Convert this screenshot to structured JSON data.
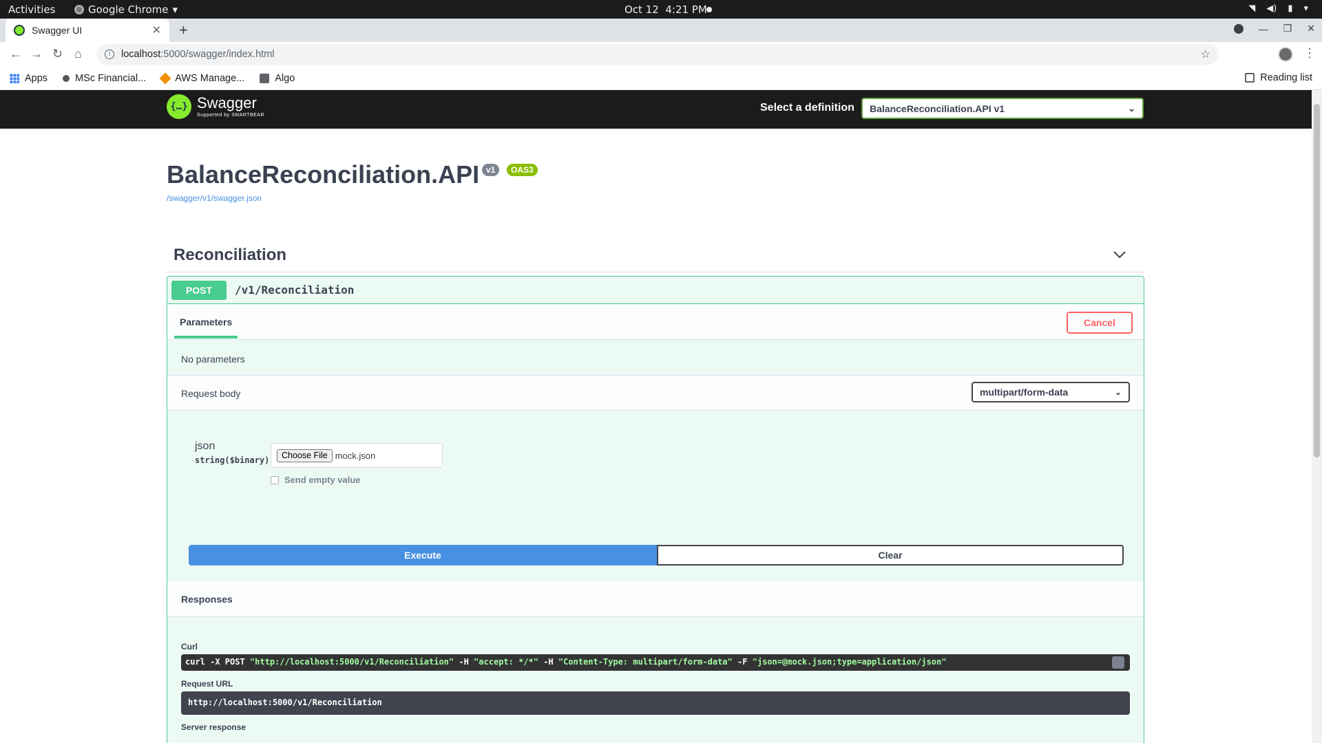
{
  "system": {
    "activities": "Activities",
    "app_name": "Google Chrome",
    "date": "Oct 12",
    "time": "4:21 PM"
  },
  "browser": {
    "tab_title": "Swagger UI",
    "url_host": "localhost",
    "url_path": ":5000/swagger/index.html",
    "bookmarks": [
      {
        "label": "Apps",
        "icon": "apps-grid-icon"
      },
      {
        "label": "MSc Financial...",
        "icon": "msc-icon"
      },
      {
        "label": "AWS Manage...",
        "icon": "aws-icon"
      },
      {
        "label": "Algo",
        "icon": "folder-icon"
      }
    ],
    "reading_list": "Reading list"
  },
  "swagger": {
    "brand": "Swagger",
    "brand_sub": "Supported by SMARTBEAR",
    "select_label": "Select a definition",
    "selected_definition": "BalanceReconciliation.API v1",
    "api_title": "BalanceReconciliation.API",
    "version_badge": "v1",
    "oas_badge": "OAS3",
    "spec_link": "/swagger/v1/swagger.json",
    "tag": "Reconciliation",
    "operation": {
      "method": "POST",
      "path": "/v1/Reconciliation",
      "parameters_tab": "Parameters",
      "cancel": "Cancel",
      "no_params": "No parameters",
      "request_body_label": "Request body",
      "content_type": "multipart/form-data",
      "field_name": "json",
      "field_type": "string($binary)",
      "choose_file": "Choose File",
      "file_name": "mock.json",
      "send_empty": "Send empty value",
      "execute": "Execute",
      "clear": "Clear",
      "responses": "Responses",
      "curl_label": "Curl",
      "curl_parts": {
        "p1": "curl -X POST ",
        "s1": "\"http://localhost:5000/v1/Reconciliation\"",
        "p2": " -H  ",
        "s2": "\"accept: */*\"",
        "p3": " -H  ",
        "s3": "\"Content-Type: multipart/form-data\"",
        "p4": " -F ",
        "s4": "\"json=@mock.json;type=application/json\""
      },
      "request_url_label": "Request URL",
      "request_url": "http://localhost:5000/v1/Reconciliation",
      "server_response_label": "Server response"
    }
  },
  "colors": {
    "post_green": "#49cc90",
    "execute_blue": "#4990e2",
    "cancel_red": "#ff6060",
    "swagger_green": "#85ea2d"
  }
}
